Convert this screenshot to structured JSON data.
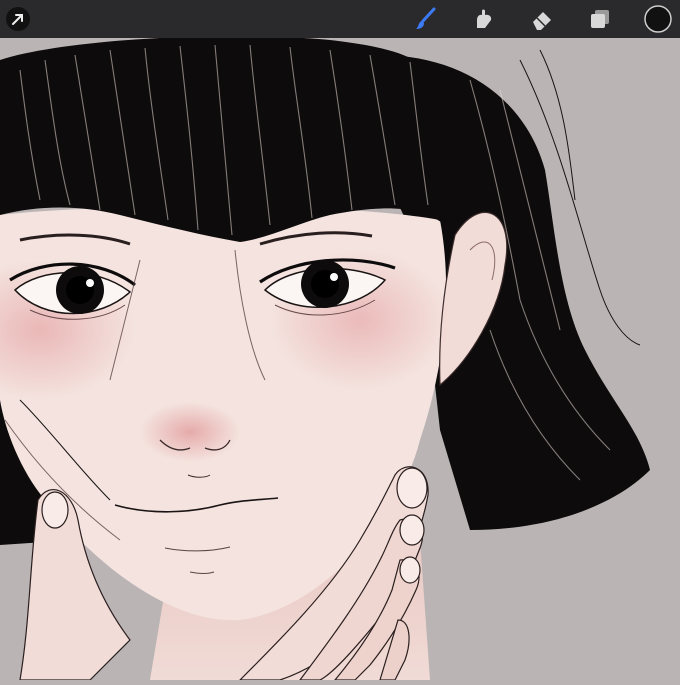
{
  "app": {
    "toolbar": {
      "tools": [
        {
          "icon": "actions-arrow-icon",
          "active": false
        },
        {
          "icon": "paintbrush-icon",
          "active": true
        },
        {
          "icon": "smudge-icon",
          "active": false
        },
        {
          "icon": "eraser-icon",
          "active": false
        },
        {
          "icon": "layers-icon",
          "active": false
        },
        {
          "icon": "color-swatch-icon",
          "active": false
        }
      ],
      "active_color": "#111111",
      "accent_color": "#3d7bf5"
    },
    "canvas": {
      "background_color": "#bbb4b5",
      "skin_color": "#f4e3df",
      "blush_color": "#e6a9a9",
      "hair_color": "#0d0b0b"
    }
  }
}
